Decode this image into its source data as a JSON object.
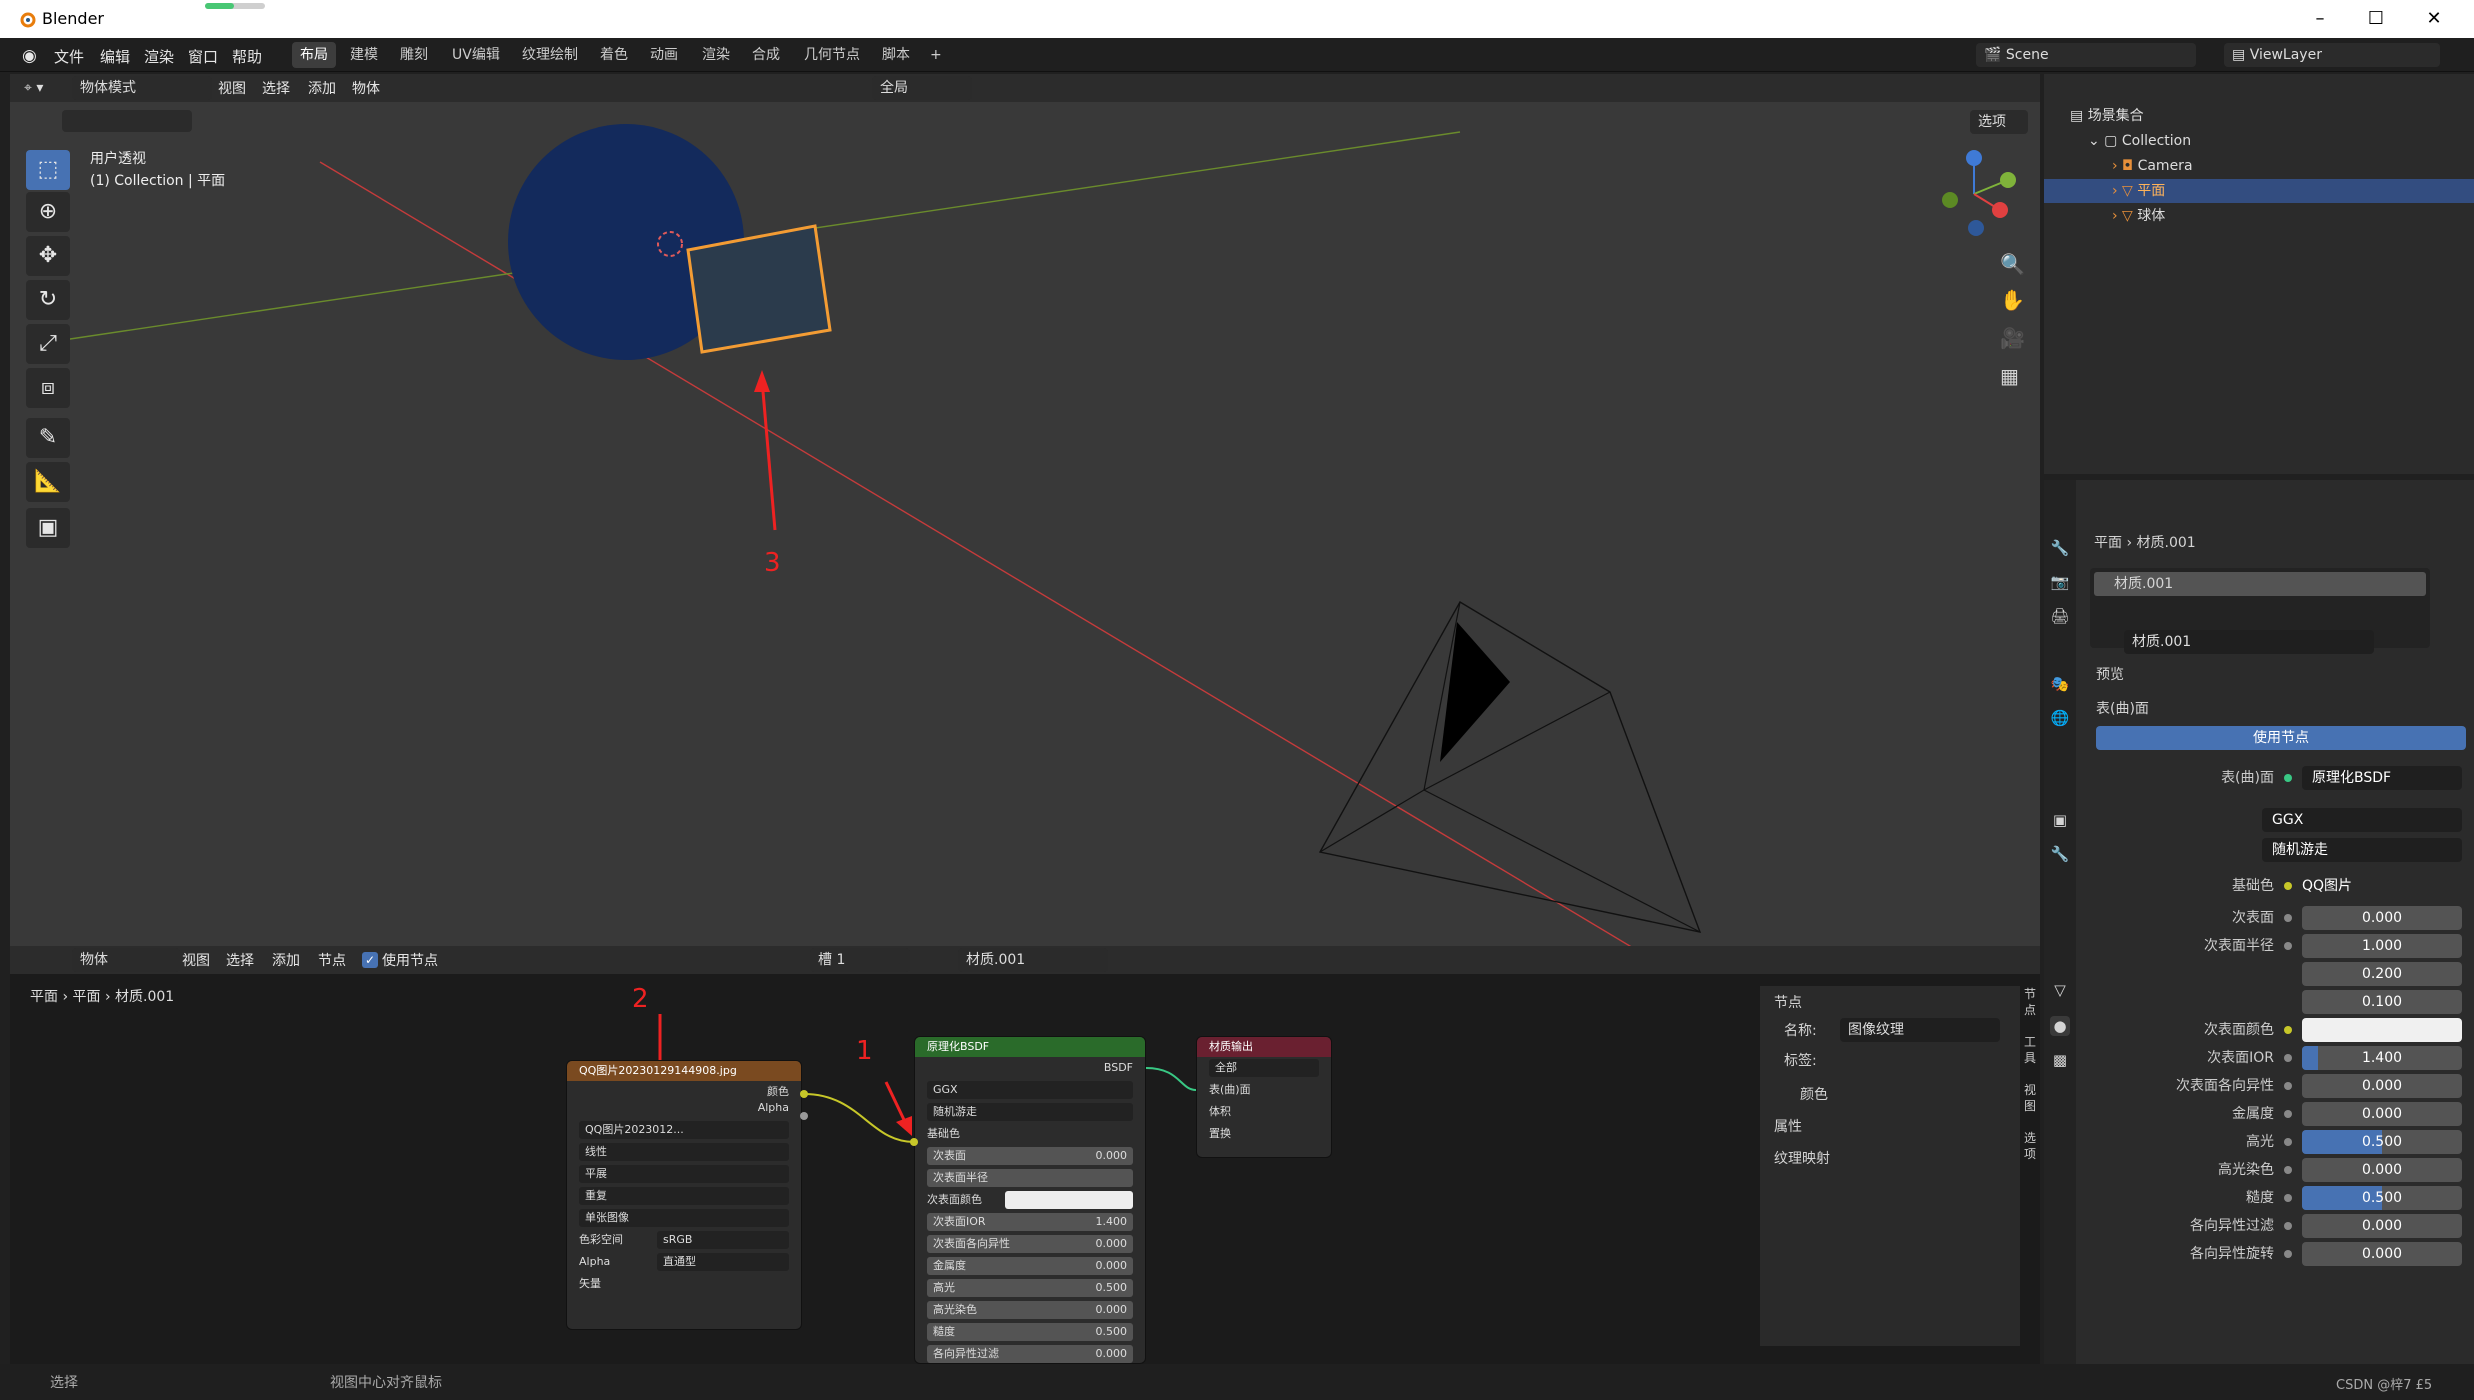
{
  "window": {
    "title": "Blender",
    "minimize": "–",
    "maximize": "☐",
    "close": "✕"
  },
  "menu": [
    "文件",
    "编辑",
    "渲染",
    "窗口",
    "帮助"
  ],
  "workspaces": [
    "布局",
    "建模",
    "雕刻",
    "UV编辑",
    "纹理绘制",
    "着色",
    "动画",
    "渲染",
    "合成",
    "几何节点",
    "脚本",
    "+"
  ],
  "scene": {
    "label": "Scene",
    "view_layer": "ViewLayer"
  },
  "viewport": {
    "mode": "物体模式",
    "menus": [
      "视图",
      "选择",
      "添加",
      "物体"
    ],
    "transform": "全局",
    "options": "选项",
    "overlay_title": "用户透视",
    "overlay_sub": "(1) Collection | 平面",
    "annotation": "3"
  },
  "node_editor": {
    "type": "物体",
    "menus": [
      "视图",
      "选择",
      "添加",
      "节点"
    ],
    "use_nodes": "使用节点",
    "slot": "槽 1",
    "material": "材质.001",
    "breadcrumb": [
      "平面",
      "平面",
      "材质.001"
    ],
    "image_node": {
      "title": "QQ图片20230129144908.jpg",
      "out_color": "颜色",
      "out_alpha": "Alpha",
      "image": "QQ图片2023012...",
      "interp": "线性",
      "proj": "平展",
      "ext": "重复",
      "src": "单张图像",
      "cs_label": "色彩空间",
      "cs_val": "sRGB",
      "alpha_label": "Alpha",
      "alpha_val": "直通型",
      "vector": "矢量"
    },
    "bsdf_node": {
      "title": "原理化BSDF",
      "out": "BSDF",
      "dist": "GGX",
      "sss": "随机游走",
      "base": "基础色",
      "rows": [
        [
          "次表面",
          "0.000"
        ],
        [
          "次表面半径",
          ""
        ],
        [
          "次表面颜色",
          ""
        ],
        [
          "次表面IOR",
          "1.400"
        ],
        [
          "次表面各向异性",
          "0.000"
        ],
        [
          "金属度",
          "0.000"
        ],
        [
          "高光",
          "0.500"
        ],
        [
          "高光染色",
          "0.000"
        ],
        [
          "糙度",
          "0.500"
        ],
        [
          "各向异性过滤",
          "0.000"
        ]
      ]
    },
    "output_node": {
      "title": "材质输出",
      "target": "全部",
      "surface": "表(曲)面",
      "volume": "体积",
      "disp": "置换"
    },
    "annotations": [
      "1",
      "2"
    ],
    "side": {
      "section": "节点",
      "name_label": "名称:",
      "name_val": "图像纹理",
      "label_label": "标签:",
      "color": "颜色",
      "props": "属性",
      "texmap": "纹理映射"
    },
    "tabs": [
      "节点",
      "工具",
      "视图",
      "选项"
    ]
  },
  "outliner": {
    "root": "场景集合",
    "items": [
      "Collection",
      "Camera",
      "平面",
      "球体"
    ]
  },
  "properties": {
    "breadcrumb": [
      "平面",
      "材质.001"
    ],
    "slot": "材质.001",
    "material": "材质.001",
    "preview": "预览",
    "surface": "表(曲)面",
    "use_nodes": "使用节点",
    "surface_label": "表(曲)面",
    "shader": "原理化BSDF",
    "dist": "GGX",
    "sss": "随机游走",
    "base_label": "基础色",
    "base_val": "QQ图片202301291449...",
    "rows": [
      [
        "次表面",
        "0.000",
        0
      ],
      [
        "次表面半径",
        "1.000",
        0
      ],
      [
        "",
        "0.200",
        0
      ],
      [
        "",
        "0.100",
        0
      ],
      [
        "次表面颜色",
        "",
        0
      ],
      [
        "次表面IOR",
        "1.400",
        0.1
      ],
      [
        "次表面各向异性",
        "0.000",
        0
      ],
      [
        "金属度",
        "0.000",
        0
      ],
      [
        "高光",
        "0.500",
        0.5
      ],
      [
        "高光染色",
        "0.000",
        0
      ],
      [
        "糙度",
        "0.500",
        0.5
      ],
      [
        "各向异性过滤",
        "0.000",
        0
      ],
      [
        "各向异性旋转",
        "0.000",
        0
      ]
    ]
  },
  "status": {
    "select": "选择",
    "center": "视图中心对齐鼠标",
    "watermark": "CSDN @梓7 £5"
  }
}
